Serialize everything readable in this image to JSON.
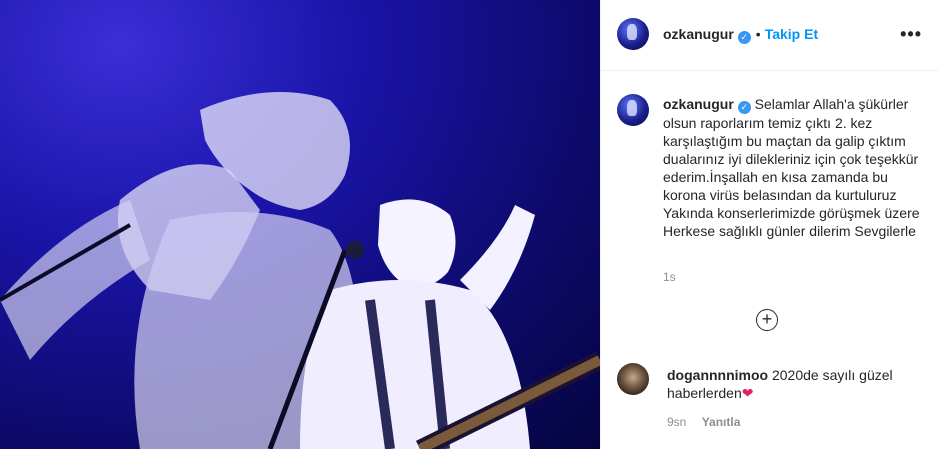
{
  "post": {
    "username": "ozkanugur",
    "verified_mark": "✓",
    "dot": "•",
    "follow_label": "Takip Et",
    "more_label": "•••",
    "caption_text": "Selamlar Allah'a şükürler olsun raporlarım temiz çıktı 2. kez karşılaştığım bu maçtan da galip çıktım dualarınız iyi dilekleriniz için çok teşekkür ederim.İnşallah en kısa zamanda bu korona virüs belasından da kurtuluruz Yakında konserlerimizde görüşmek üzere Herkese sağlıklı günler dilerim Sevgilerle",
    "caption_time": "1s",
    "load_more_icon": "plus-circle-icon"
  },
  "comment": {
    "username": "dogannnnimoo",
    "text": "2020de sayılı güzel haberlerden",
    "heart": "❤",
    "time": "9sn",
    "reply_label": "Yanıtla"
  },
  "colors": {
    "follow": "#0095f6",
    "verified": "#3897f0",
    "muted": "#8e8e8e",
    "photo_base": "#1a14a8"
  }
}
